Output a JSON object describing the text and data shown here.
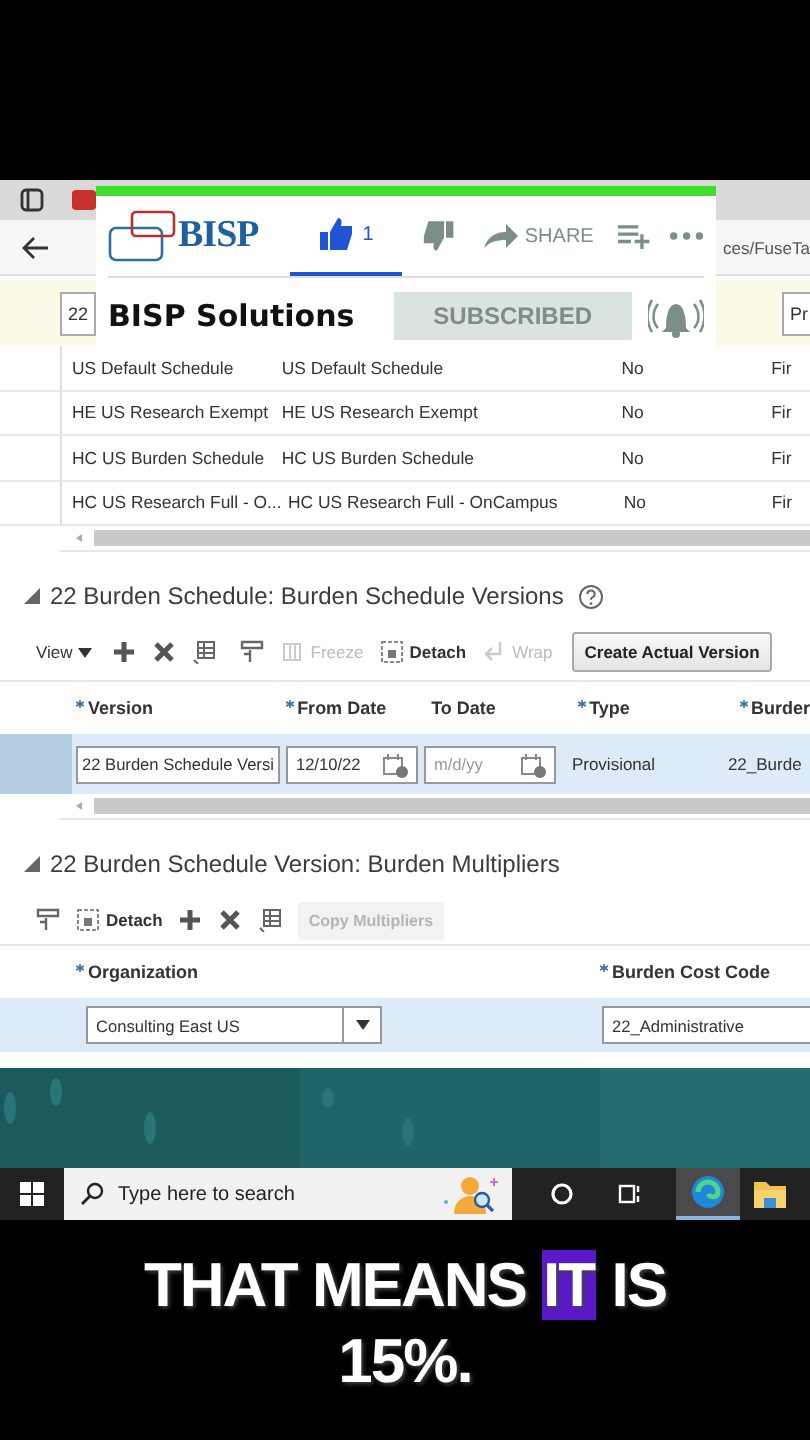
{
  "browser": {
    "address_fragment": "ces/FuseTa"
  },
  "video_overlay": {
    "channel_logo": "BISP",
    "like": {
      "count": "1",
      "selected": true
    },
    "share_label": "SHARE",
    "channel_name": "BISP Solutions",
    "subscribe_button": {
      "label": "SUBSCRIBED",
      "subscribed": true
    }
  },
  "schedules_table": {
    "partial_row": {
      "cells": [
        "22",
        "Pr"
      ],
      "selected": true
    },
    "rows": [
      {
        "cells": [
          "US Default Schedule",
          "US Default Schedule",
          "No",
          "Fir"
        ]
      },
      {
        "cells": [
          "HE US Research Exempt",
          "HE US Research Exempt",
          "No",
          "Fir"
        ]
      },
      {
        "cells": [
          "HC US Burden Schedule",
          "HC US Burden Schedule",
          "No",
          "Fir"
        ]
      },
      {
        "cells": [
          "HC US Research Full - O...",
          "HC US Research Full - OnCampus",
          "No",
          "Fir"
        ]
      }
    ]
  },
  "versions_section": {
    "title": "22 Burden Schedule: Burden Schedule Versions",
    "expanded": true,
    "toolbar": {
      "view_menu": "View",
      "freeze": {
        "label": "Freeze",
        "disabled": true
      },
      "detach": {
        "label": "Detach",
        "disabled": false
      },
      "wrap": {
        "label": "Wrap",
        "disabled": true
      },
      "create_button": "Create Actual Version"
    },
    "columns": [
      {
        "label": "Version",
        "required": true
      },
      {
        "label": "From Date",
        "required": true
      },
      {
        "label": "To Date",
        "required": false
      },
      {
        "label": "Type",
        "required": true
      },
      {
        "label": "Burder",
        "required": true
      }
    ],
    "rows": [
      {
        "selected": true,
        "version": {
          "value": "22 Burden Schedule Versi"
        },
        "from_date": {
          "value": "12/10/22"
        },
        "to_date": {
          "placeholder": "m/d/yy"
        },
        "type": "Provisional",
        "burden": "22_Burde"
      }
    ]
  },
  "multipliers_section": {
    "title": "22 Burden Schedule Version: Burden Multipliers",
    "expanded": true,
    "toolbar": {
      "detach": {
        "label": "Detach",
        "disabled": false
      },
      "copy_button": {
        "label": "Copy Multipliers",
        "disabled": true
      }
    },
    "columns": [
      {
        "label": "Organization",
        "required": true
      },
      {
        "label": "Burden Cost Code",
        "required": true
      }
    ],
    "rows": [
      {
        "selected": true,
        "organization": "Consulting East US",
        "burden_cost_code": "22_Administrative"
      }
    ]
  },
  "taskbar": {
    "search_placeholder": "Type here to search"
  },
  "caption": {
    "lines": [
      {
        "words": [
          {
            "text": "THAT",
            "highlighted": false
          },
          {
            "text": "MEANS",
            "highlighted": false
          },
          {
            "text": "IT",
            "highlighted": true
          },
          {
            "text": "IS",
            "highlighted": false
          }
        ]
      },
      {
        "words": [
          {
            "text": "15%.",
            "highlighted": false
          }
        ]
      }
    ]
  }
}
